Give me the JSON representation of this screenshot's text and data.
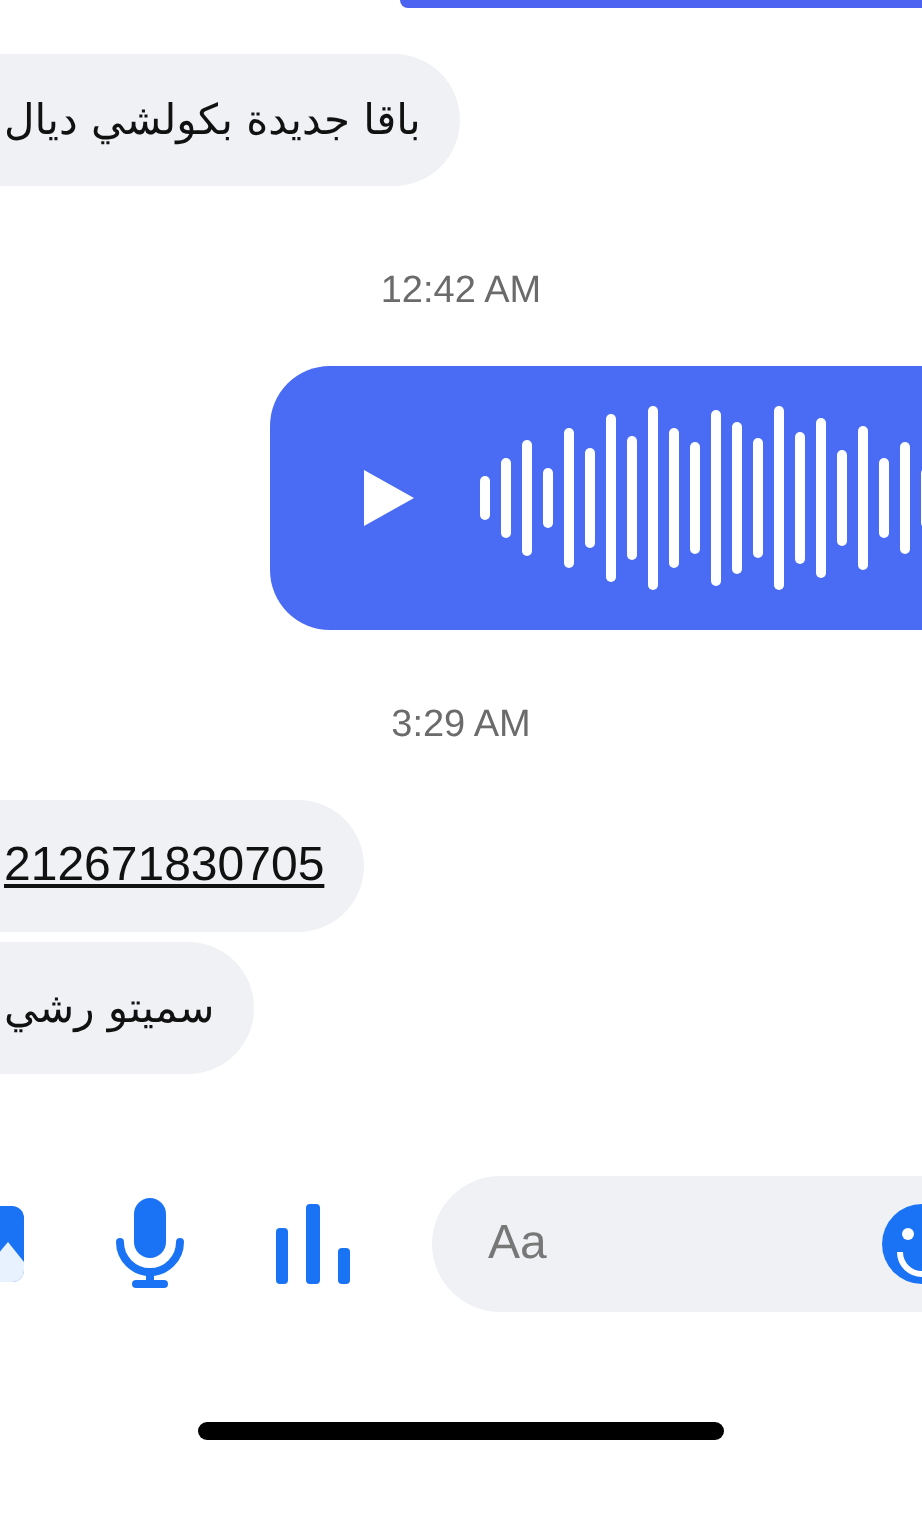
{
  "messages": [
    {
      "kind": "outgoing_cut"
    },
    {
      "kind": "incoming",
      "text": "باقا جديدة بكولشي ديال"
    },
    {
      "kind": "timestamp",
      "text": "12:42 AM"
    },
    {
      "kind": "voice"
    },
    {
      "kind": "timestamp",
      "text": "3:29 AM"
    },
    {
      "kind": "link",
      "text": "212671830705"
    },
    {
      "kind": "incoming",
      "text": "سميتو رشي"
    }
  ],
  "composer": {
    "placeholder": "Aa"
  }
}
